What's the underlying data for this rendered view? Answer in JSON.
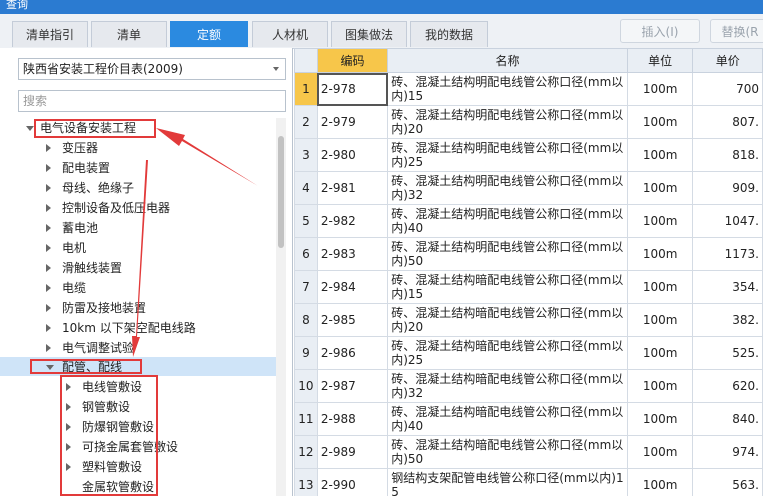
{
  "window": {
    "title": "查询"
  },
  "tabs": [
    {
      "label": "清单指引",
      "active": false
    },
    {
      "label": "清单",
      "active": false
    },
    {
      "label": "定额",
      "active": true
    },
    {
      "label": "人材机",
      "active": false
    },
    {
      "label": "图集做法",
      "active": false
    },
    {
      "label": "我的数据",
      "active": false
    }
  ],
  "actions": {
    "insert_label": "插入(I)",
    "replace_label": "替换(R"
  },
  "left": {
    "catalog_select": "陕西省安装工程价目表(2009)",
    "search_placeholder": "搜索",
    "tree": [
      {
        "label": "电气设备安装工程",
        "level": 0,
        "expanded": true
      },
      {
        "label": "变压器",
        "level": 1
      },
      {
        "label": "配电装置",
        "level": 1
      },
      {
        "label": "母线、绝缘子",
        "level": 1
      },
      {
        "label": "控制设备及低压电器",
        "level": 1
      },
      {
        "label": "蓄电池",
        "level": 1
      },
      {
        "label": "电机",
        "level": 1
      },
      {
        "label": "滑触线装置",
        "level": 1
      },
      {
        "label": "电缆",
        "level": 1
      },
      {
        "label": "防雷及接地装置",
        "level": 1
      },
      {
        "label": "10km 以下架空配电线路",
        "level": 1
      },
      {
        "label": "电气调整试验",
        "level": 1
      },
      {
        "label": "配管、配线",
        "level": 1,
        "expanded": true,
        "selected": true
      },
      {
        "label": "电线管敷设",
        "level": 2
      },
      {
        "label": "钢管敷设",
        "level": 2
      },
      {
        "label": "防爆钢管敷设",
        "level": 2
      },
      {
        "label": "可挠金属套管敷设",
        "level": 2
      },
      {
        "label": "塑料管敷设",
        "level": 2
      },
      {
        "label": "金属软管敷设",
        "level": 2
      }
    ]
  },
  "grid": {
    "headers": {
      "code": "编码",
      "name": "名称",
      "unit": "单位",
      "price": "单价"
    },
    "rows": [
      {
        "idx": "1",
        "code": "2-978",
        "name": "砖、混凝土结构明配电线管公称口径(mm以内)15",
        "unit": "100m",
        "price": "700"
      },
      {
        "idx": "2",
        "code": "2-979",
        "name": "砖、混凝土结构明配电线管公称口径(mm以内)20",
        "unit": "100m",
        "price": "807."
      },
      {
        "idx": "3",
        "code": "2-980",
        "name": "砖、混凝土结构明配电线管公称口径(mm以内)25",
        "unit": "100m",
        "price": "818."
      },
      {
        "idx": "4",
        "code": "2-981",
        "name": "砖、混凝土结构明配电线管公称口径(mm以内)32",
        "unit": "100m",
        "price": "909."
      },
      {
        "idx": "5",
        "code": "2-982",
        "name": "砖、混凝土结构明配电线管公称口径(mm以内)40",
        "unit": "100m",
        "price": "1047."
      },
      {
        "idx": "6",
        "code": "2-983",
        "name": "砖、混凝土结构明配电线管公称口径(mm以内)50",
        "unit": "100m",
        "price": "1173."
      },
      {
        "idx": "7",
        "code": "2-984",
        "name": "砖、混凝土结构暗配电线管公称口径(mm以内)15",
        "unit": "100m",
        "price": "354."
      },
      {
        "idx": "8",
        "code": "2-985",
        "name": "砖、混凝土结构暗配电线管公称口径(mm以内)20",
        "unit": "100m",
        "price": "382."
      },
      {
        "idx": "9",
        "code": "2-986",
        "name": "砖、混凝土结构暗配电线管公称口径(mm以内)25",
        "unit": "100m",
        "price": "525."
      },
      {
        "idx": "10",
        "code": "2-987",
        "name": "砖、混凝土结构暗配电线管公称口径(mm以内)32",
        "unit": "100m",
        "price": "620."
      },
      {
        "idx": "11",
        "code": "2-988",
        "name": "砖、混凝土结构暗配电线管公称口径(mm以内)40",
        "unit": "100m",
        "price": "840."
      },
      {
        "idx": "12",
        "code": "2-989",
        "name": "砖、混凝土结构暗配电线管公称口径(mm以内)50",
        "unit": "100m",
        "price": "974."
      },
      {
        "idx": "13",
        "code": "2-990",
        "name": "钢结构支架配管电线管公称口径(mm以内)15",
        "unit": "100m",
        "price": "563."
      }
    ]
  },
  "colors": {
    "accent": "#2b8ae0",
    "selected_cell": "#f7c64a",
    "annotation": "#e23a3a"
  }
}
